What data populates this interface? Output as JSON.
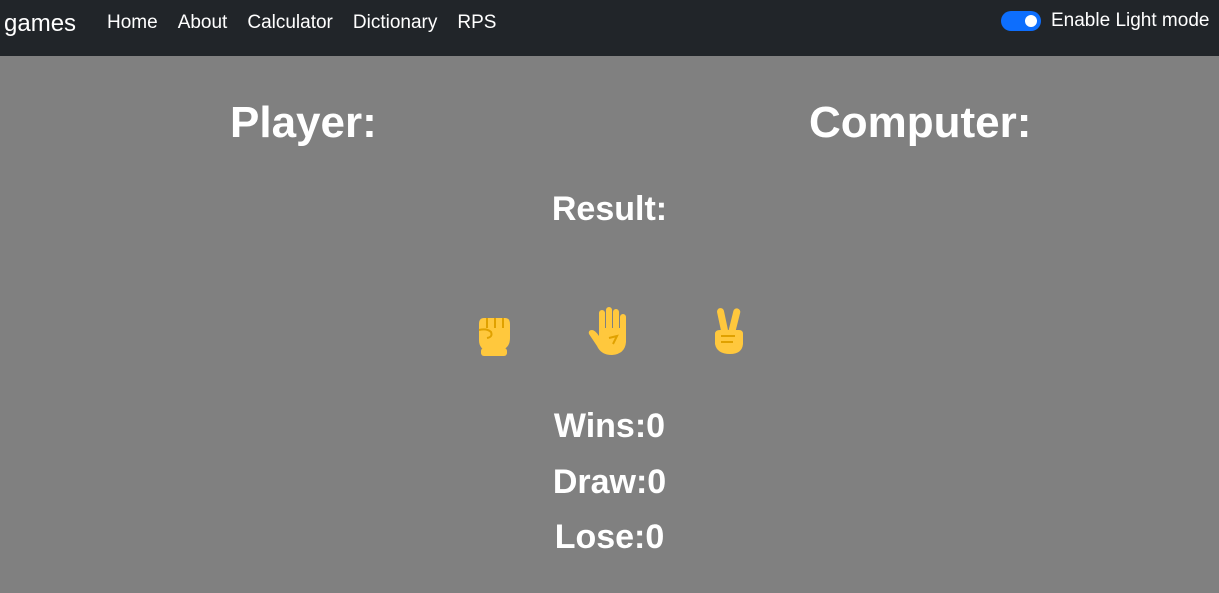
{
  "navbar": {
    "brand": "games",
    "links": [
      "Home",
      "About",
      "Calculator",
      "Dictionary",
      "RPS"
    ],
    "toggle_label": "Enable Light mode",
    "toggle_on": true
  },
  "game": {
    "player_label": "Player:",
    "computer_label": "Computer:",
    "result_label": "Result:",
    "choices": [
      {
        "name": "rock",
        "icon": "raised-fist-icon",
        "glyph": "✊"
      },
      {
        "name": "paper",
        "icon": "raised-hand-icon",
        "glyph": "✋"
      },
      {
        "name": "scissors",
        "icon": "victory-hand-icon",
        "glyph": "✌"
      }
    ],
    "wins_text": "Wins:0",
    "draw_text": "Draw:0",
    "lose_text": "Lose:0"
  },
  "colors": {
    "navbar_bg": "#212529",
    "page_bg": "#808080",
    "toggle_accent": "#0d6efd",
    "emoji_yellow": "#FFC83D",
    "emoji_shade": "#E0A100"
  }
}
